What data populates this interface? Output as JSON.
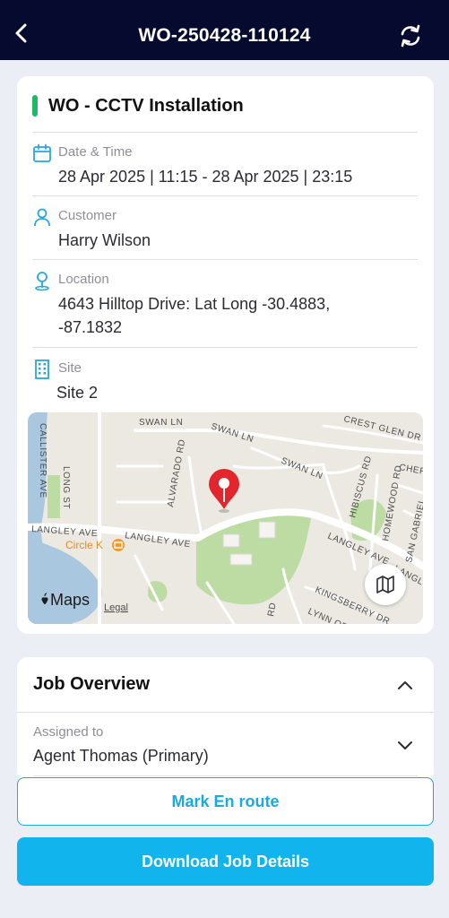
{
  "header": {
    "title": "WO-250428-110124",
    "back_icon": "chevron-left-icon",
    "refresh_icon": "refresh-icon"
  },
  "work_order": {
    "title": "WO - CCTV Installation",
    "status_color": "#1fb866",
    "fields": {
      "date_time": {
        "label": "Date & Time",
        "value": "28 Apr 2025 | 11:15 - 28 Apr 2025 | 23:15",
        "icon": "calendar-icon"
      },
      "customer": {
        "label": "Customer",
        "value": "Harry Wilson",
        "icon": "person-icon"
      },
      "location": {
        "label": "Location",
        "value": "4643 Hilltop Drive: Lat Long -30.4883, -87.1832",
        "icon": "location-pin-icon"
      },
      "site": {
        "label": "Site",
        "value": "Site 2",
        "icon": "building-icon"
      }
    }
  },
  "map": {
    "streets": [
      "SWAN LN",
      "SWAN LN",
      "SWAN LN",
      "CREST GLEN DR",
      "CHER",
      "LONG ST",
      "ALVARADO RD",
      "HIBISCUS RD",
      "HOMEWOOD RD",
      "SAN GABRIEL",
      "LANGLEY AVE",
      "LANGLEY AVE",
      "LANGLEY AVE",
      "LANGL",
      "KINGSBERRY DR",
      "LYNN OR",
      "RD",
      "CALLISTER AVE"
    ],
    "poi": "Circle K",
    "attribution": "Maps",
    "legal": "Legal",
    "map_button_icon": "map-icon"
  },
  "job_overview": {
    "title": "Job Overview",
    "assigned_label": "Assigned to",
    "assigned_value": "Agent Thomas (Primary)"
  },
  "actions": {
    "en_route": "Mark En route",
    "download": "Download Job Details"
  },
  "colors": {
    "header_bg": "#050a2e",
    "accent": "#12b4ee",
    "icon_blue": "#2ba6dc",
    "pin_red": "#e2262d"
  }
}
